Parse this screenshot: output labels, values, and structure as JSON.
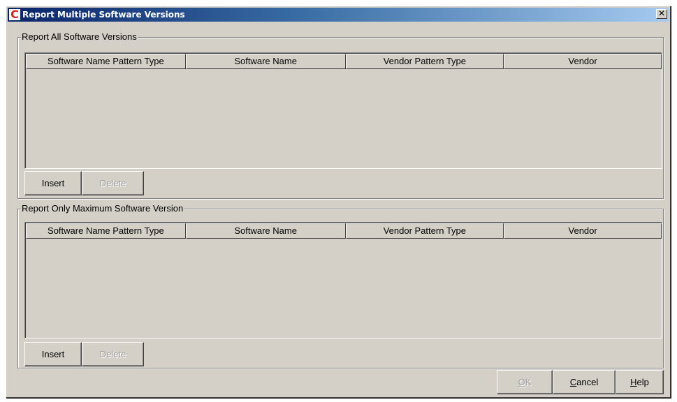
{
  "window": {
    "title": "Report Multiple Software Versions",
    "app_icon_letter": "C",
    "close_glyph": "✕"
  },
  "groups": [
    {
      "label": "Report All Software Versions",
      "columns": [
        "Software Name Pattern Type",
        "Software Name",
        "Vendor Pattern Type",
        "Vendor"
      ],
      "insert_label": "Insert",
      "delete_label": "Delete"
    },
    {
      "label": "Report Only Maximum Software Version",
      "columns": [
        "Software Name Pattern Type",
        "Software Name",
        "Vendor Pattern Type",
        "Vendor"
      ],
      "insert_label": "Insert",
      "delete_label": "Delete"
    }
  ],
  "footer": {
    "ok": {
      "mnemonic": "O",
      "rest": "K",
      "disabled": true
    },
    "cancel": {
      "mnemonic": "C",
      "rest": "ancel"
    },
    "help": {
      "mnemonic": "H",
      "rest": "elp"
    }
  },
  "colors": {
    "dialog_bg": "#d4d0c8",
    "title_gradient_start": "#0a246a",
    "title_gradient_end": "#a6caf0",
    "app_icon_red": "#e0201e"
  }
}
